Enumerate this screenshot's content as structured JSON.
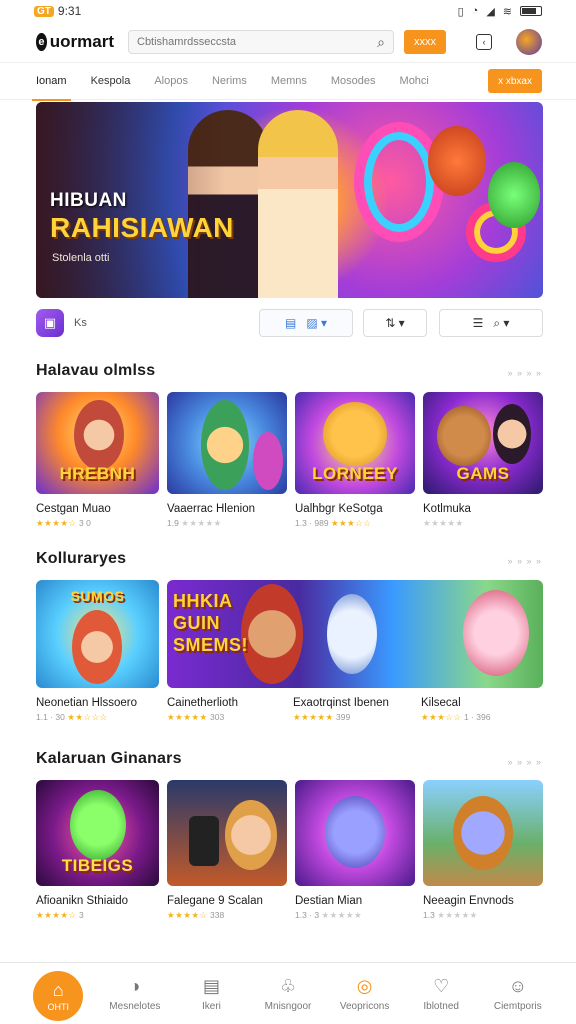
{
  "status": {
    "time": "9:31",
    "carrier": "GT"
  },
  "header": {
    "brand": "uormart",
    "search_placeholder": "Cbtishamrdsseccsta",
    "search_button": "xxxx"
  },
  "tabs": [
    {
      "label": "Ionam",
      "active": true
    },
    {
      "label": "Kespola",
      "active": false
    },
    {
      "label": "Alopos",
      "active": false
    },
    {
      "label": "Nerims",
      "active": false
    },
    {
      "label": "Memns",
      "active": false
    },
    {
      "label": "Mosodes",
      "active": false
    },
    {
      "label": "Mohci",
      "active": false
    }
  ],
  "tabs_cta": "x xbxax",
  "hero": {
    "title_line1": "HIBUAN",
    "title_line2": "RAHISIAWAN",
    "subtitle": "Stolenla otti"
  },
  "toolbar": {
    "label": "Ks"
  },
  "sections": [
    {
      "title": "Halavau olmlss",
      "more": "» » » »",
      "cards": [
        {
          "name": "Cestgan Muao",
          "stars": "★★★★☆",
          "meta": "3 0",
          "caption": "HREBNH"
        },
        {
          "name": "Vaaerrac Hlenion",
          "stars": "★★★★★",
          "meta": "1.9",
          "caption": ""
        },
        {
          "name": "Ualhbgr KeSotga",
          "stars": "★★★☆☆",
          "meta": "1.3 · 989",
          "caption": "LORNEEY"
        },
        {
          "name": "Kotlmuka",
          "stars": "★★★★★",
          "meta": "",
          "caption": "GAMS"
        }
      ]
    },
    {
      "title": "Kolluraryes",
      "more": "» » » »",
      "cards": [
        {
          "name": "Neonetian Hlssoero",
          "stars": "★★☆☆☆",
          "meta": "1.1 · 30",
          "caption": "SUMOS"
        },
        {
          "name": "Cainetherlioth",
          "stars": "★★★★★",
          "meta": "303",
          "caption": "HHKIA GUIN SMEMS!"
        },
        {
          "name": "Exaotrqinst Ibenen",
          "stars": "★★★★★",
          "meta": "399",
          "caption": ""
        },
        {
          "name": "Kilsecal",
          "stars": "★★★☆☆",
          "meta": "1 · 396",
          "caption": ""
        }
      ]
    },
    {
      "title": "Kalaruan Ginanars",
      "more": "» » » »",
      "cards": [
        {
          "name": "Afioanikn Sthiaido",
          "stars": "★★★★☆",
          "meta": "3",
          "caption": "TIBEIGS"
        },
        {
          "name": "Falegane 9 Scalan",
          "stars": "★★★★☆",
          "meta": "338",
          "caption": ""
        },
        {
          "name": "Destian Mian",
          "stars": "★★★★★",
          "meta": "1.3 · 3",
          "caption": ""
        },
        {
          "name": "Neeagin Envnods",
          "stars": "★★★★★",
          "meta": "1.3",
          "caption": ""
        }
      ]
    }
  ],
  "bottom_nav": [
    {
      "label": "OHTI",
      "icon": "home-icon"
    },
    {
      "label": "Mesnelotes",
      "icon": "compass-icon"
    },
    {
      "label": "Ikeri",
      "icon": "list-icon"
    },
    {
      "label": "Mnisngoor",
      "icon": "group-icon"
    },
    {
      "label": "Veopricons",
      "icon": "ring-icon"
    },
    {
      "label": "Iblotned",
      "icon": "bubble-icon"
    },
    {
      "label": "Ciemtporis",
      "icon": "profile-icon"
    }
  ],
  "colors": {
    "accent": "#f7941d",
    "star": "#f5b21a"
  }
}
